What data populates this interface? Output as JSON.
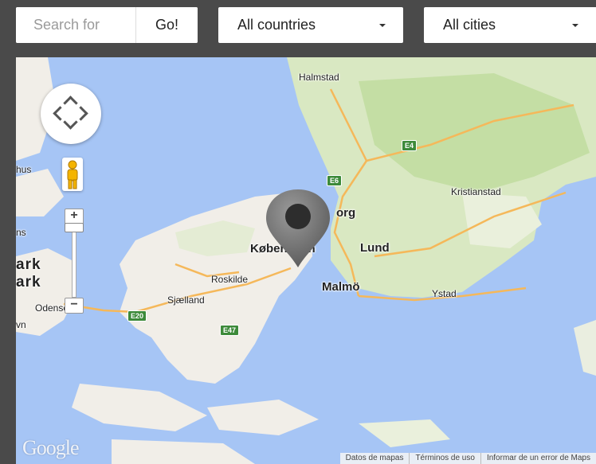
{
  "search": {
    "placeholder": "Search for",
    "value": "",
    "button_label": "Go!"
  },
  "filters": {
    "country": {
      "selected": "All countries"
    },
    "city": {
      "selected": "All cities"
    }
  },
  "map": {
    "labels": {
      "halmstad": "Halmstad",
      "kristianstad": "Kristianstad",
      "helsingborg_partial": "org",
      "lund": "Lund",
      "kobenhavn": "København",
      "roskilde": "Roskilde",
      "malmo": "Malmö",
      "ystad": "Ystad",
      "sjaelland": "Sjælland",
      "odense": "Odense",
      "denmark_partial_1": "ark",
      "denmark_partial_2": "ark",
      "partial_hus": "hus",
      "partial_ns": "ns",
      "partial_vn": "vn"
    },
    "road_shields": {
      "e4": "E4",
      "e6": "E6",
      "e20": "E20",
      "e47": "E47"
    },
    "controls": {
      "zoom_in": "+",
      "zoom_out": "−",
      "zoom_level_fraction": 0.05
    },
    "marker_location": "København",
    "logo": "Google",
    "attribution": {
      "map_data": "Datos de mapas",
      "terms": "Términos de uso",
      "report": "Informar de un error de Maps"
    },
    "colors": {
      "water": "#a6c5f5",
      "land_green": "#cde3b0",
      "land_light": "#f1eee8",
      "roads": "#f5b85a",
      "shield": "#3d8a3a",
      "pin": "#6b6b6b"
    }
  }
}
